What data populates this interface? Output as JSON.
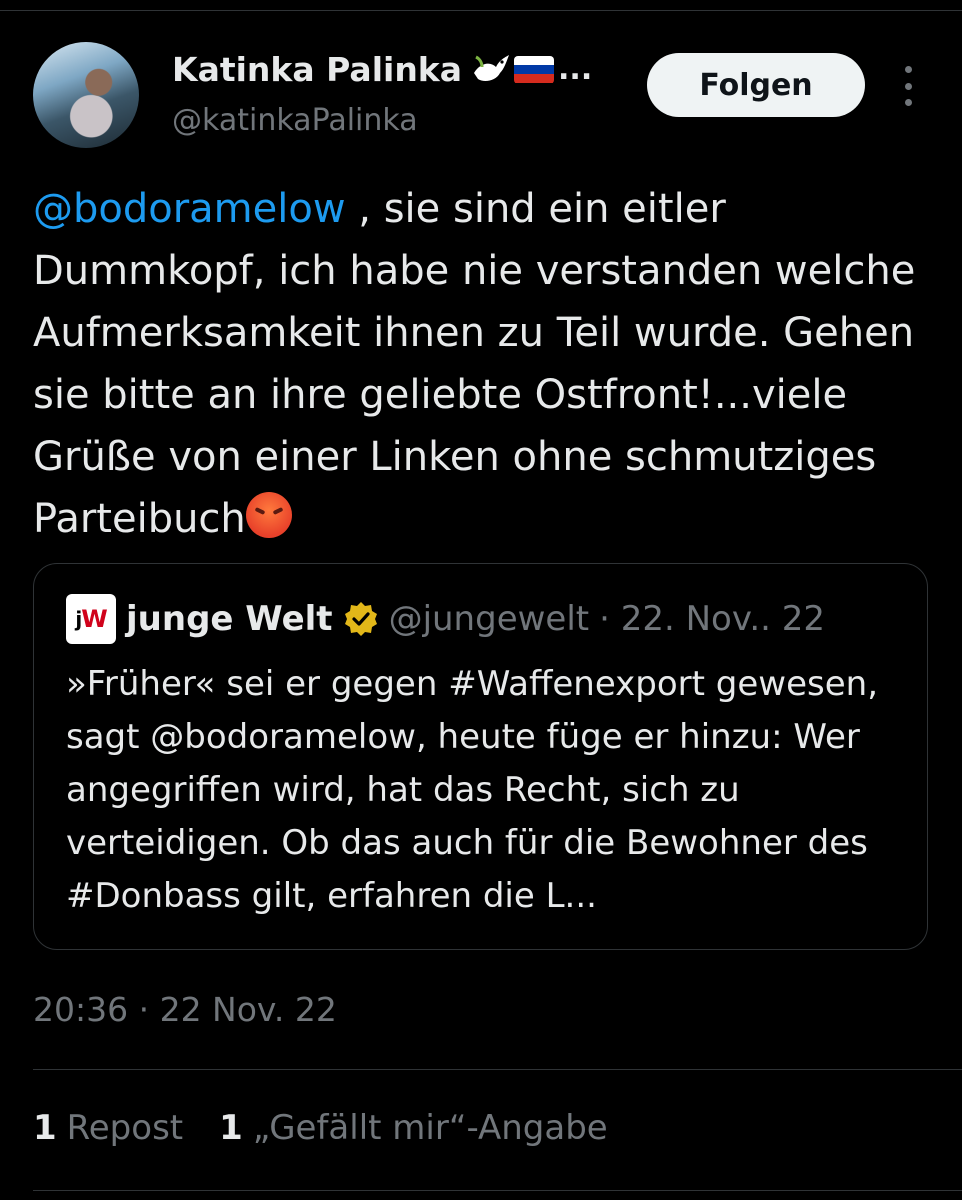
{
  "author": {
    "name": "Katinka Palinka",
    "handle": "@katinkaPalinka",
    "badges_overflow": "..."
  },
  "header": {
    "follow_label": "Folgen"
  },
  "tweet": {
    "mention": "@bodoramelow",
    "text": " , sie sind ein eitler Dummkopf, ich habe nie verstanden welche Aufmerksamkeit ihnen zu Teil wurde. Gehen sie bitte an ihre geliebte Ostfront!...viele Grüße von einer Linken ohne schmutziges Parteibuch"
  },
  "quote": {
    "logo": "jW",
    "name": "junge Welt",
    "handle": "@jungewelt",
    "date": "· 22. Nov.. 22",
    "text": "»Früher« sei er gegen #Waffenexport gewesen, sagt @bodoramelow, heute füge er hinzu: Wer angegriffen wird, hat das Recht, sich zu verteidigen. Ob das auch für die Bewohner des #Donbass gilt, erfahren die L..."
  },
  "timestamp": "20:36 · 22 Nov. 22",
  "stats": {
    "reposts": {
      "count": "1",
      "label": "Repost"
    },
    "likes": {
      "count": "1",
      "label": "„Gefällt mir“-Angabe"
    }
  },
  "colors": {
    "background": "#000000",
    "text": "#e7e9ea",
    "muted": "#71767b",
    "link": "#1d9bf0",
    "border": "#2f3336",
    "verified_gold": "#e2b719"
  }
}
